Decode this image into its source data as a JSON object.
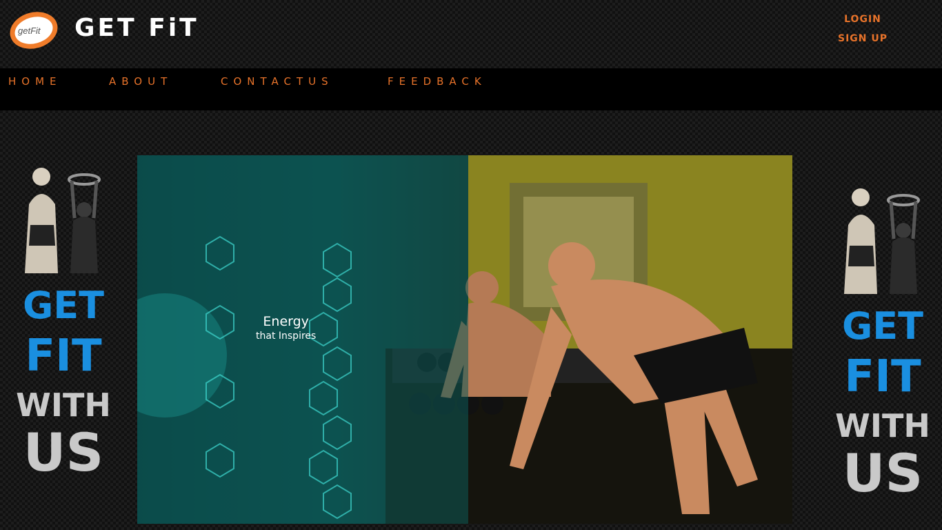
{
  "header": {
    "logo_badge_text": "getFit",
    "brand_title": "GET FiT",
    "login_label": "LOGIN",
    "signup_label": "SIGN UP"
  },
  "nav": {
    "items": [
      {
        "label": "HOME"
      },
      {
        "label": "ABOUT"
      },
      {
        "label": "CONTACTUS"
      },
      {
        "label": "FEEDBACK"
      }
    ]
  },
  "promo_left": {
    "line1": "GET",
    "line2": "FIT",
    "line3": "WITH",
    "line4": "US"
  },
  "promo_right": {
    "line1": "GET",
    "line2": "FIT",
    "line3": "WITH",
    "line4": "US"
  },
  "video": {
    "caption_main": "Energy",
    "caption_sub": "that Inspires"
  },
  "colors": {
    "accent_orange": "#e8732a",
    "promo_blue": "#1a8fe0",
    "promo_grey": "#c9c9c9",
    "navbar_bg": "#000000"
  }
}
